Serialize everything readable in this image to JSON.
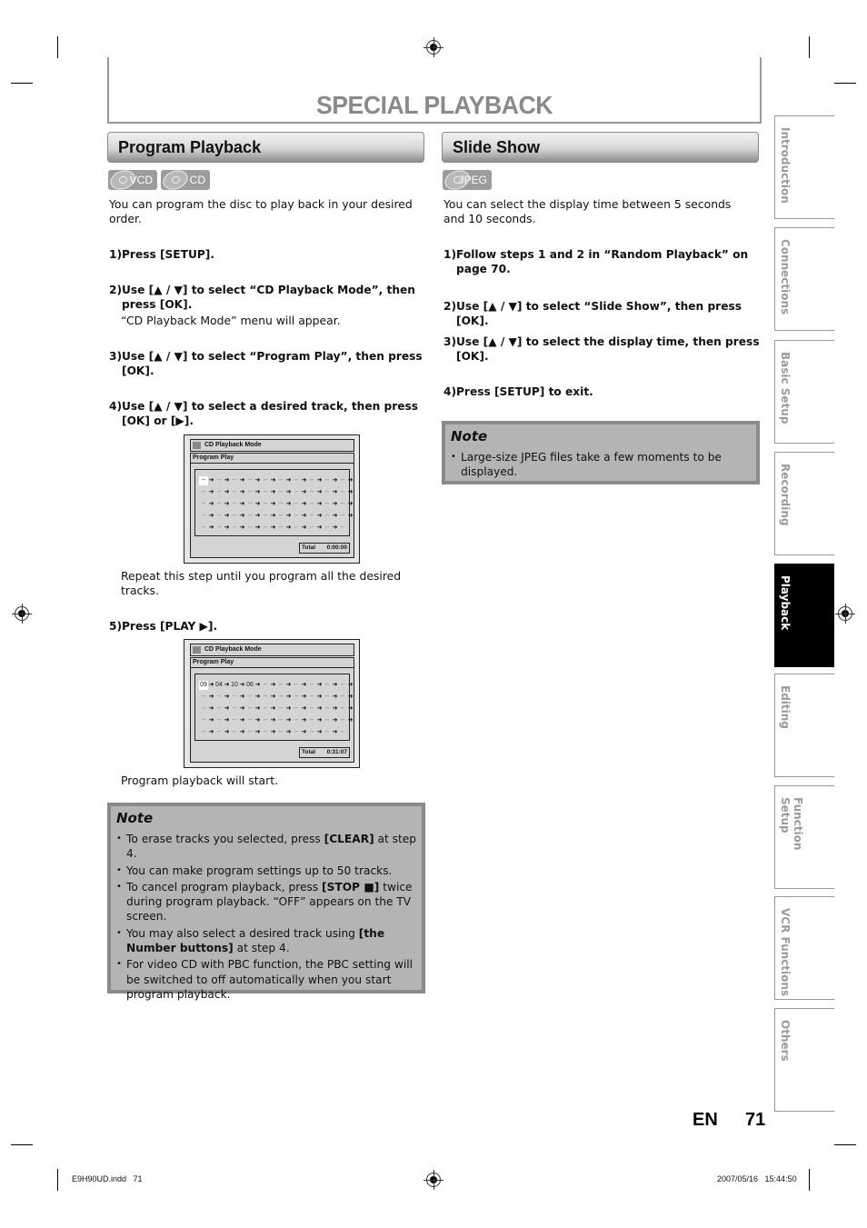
{
  "page": {
    "title": "SPECIAL PLAYBACK",
    "lang_label": "EN",
    "page_number": "71"
  },
  "side_tabs": [
    {
      "label": "Introduction",
      "active": false
    },
    {
      "label": "Connections",
      "active": false
    },
    {
      "label": "Basic Setup",
      "active": false
    },
    {
      "label": "Recording",
      "active": false
    },
    {
      "label": "Playback",
      "active": true
    },
    {
      "label": "Editing",
      "active": false
    },
    {
      "label": "Function Setup",
      "active": false
    },
    {
      "label": "VCR Functions",
      "active": false
    },
    {
      "label": "Others",
      "active": false
    }
  ],
  "program_playback": {
    "header": "Program Playback",
    "badges": [
      "VCD",
      "CD"
    ],
    "intro": "You can program the disc to play back in your desired order.",
    "steps": [
      {
        "num": "1)",
        "text": "Press [SETUP]."
      },
      {
        "num": "2)",
        "text": "Use [▲ / ▼] to select “CD Playback Mode”, then press [OK].",
        "sub": "“CD Playback Mode” menu will appear."
      },
      {
        "num": "3)",
        "text": "Use [▲ / ▼] to select “Program Play”, then press [OK]."
      },
      {
        "num": "4)",
        "text": "Use [▲ / ▼] to select a desired track, then press [OK] or [▶].",
        "sub": "Repeat this step until you program all the desired tracks."
      },
      {
        "num": "5)",
        "text": "Press [PLAY ▶].",
        "sub": "Program playback will start."
      }
    ],
    "screen1": {
      "menu_title": "CD Playback Mode",
      "submenu": "Program Play",
      "tracks": [],
      "total_label": "Total",
      "total_value": "0:00:00"
    },
    "screen2": {
      "menu_title": "CD Playback Mode",
      "submenu": "Program Play",
      "tracks": [
        "09",
        "04",
        "10",
        "06"
      ],
      "total_label": "Total",
      "total_value": "0:31:07"
    },
    "note": {
      "title": "Note",
      "items": [
        "To erase tracks you selected, press [CLEAR] at step 4.",
        "You can make program settings up to 50 tracks.",
        "To cancel program playback, press [STOP ■] twice during program playback. “OFF” appears on the TV screen.",
        "You may also select a desired track using [the Number buttons] at step 4.",
        "For video CD with PBC function, the PBC setting will be switched to off automatically when you start program playback."
      ]
    }
  },
  "slide_show": {
    "header": "Slide Show",
    "badges": [
      "JPEG"
    ],
    "intro": "You can select the display time between 5 seconds and 10 seconds.",
    "steps": [
      {
        "num": "1)",
        "text": "Follow steps 1 and 2 in “Random Playback” on page 70."
      },
      {
        "num": "2)",
        "text": "Use [▲ / ▼] to select “Slide Show”, then press [OK]."
      },
      {
        "num": "3)",
        "text": "Use [▲ / ▼] to select the display time, then press [OK]."
      },
      {
        "num": "4)",
        "text": "Press [SETUP] to exit."
      }
    ],
    "note": {
      "title": "Note",
      "items": [
        "Large-size JPEG files take a few moments to be displayed."
      ]
    }
  },
  "footer": {
    "file": "E9H90UD.indd   71",
    "timestamp": "2007/05/16   15:44:50"
  }
}
